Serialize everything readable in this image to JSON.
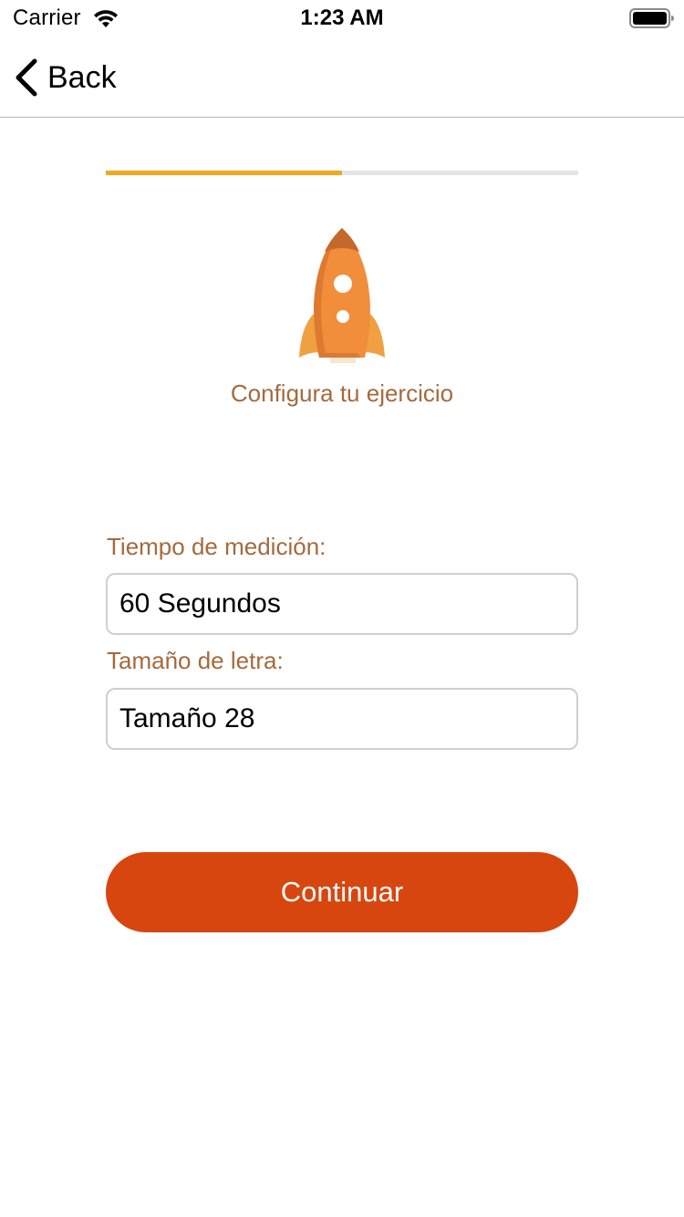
{
  "status_bar": {
    "carrier": "Carrier",
    "time": "1:23 AM",
    "wifi_icon": "wifi-icon",
    "battery_icon": "battery-icon"
  },
  "nav": {
    "back_label": "Back",
    "back_icon": "chevron-left-icon"
  },
  "progress": {
    "fraction": 0.5,
    "fill_color": "#f2a81c",
    "track_color": "#e5e5e5"
  },
  "header": {
    "illustration_icon": "rocket-icon",
    "subtitle": "Configura tu ejercicio"
  },
  "form": {
    "time_label": "Tiempo de medición:",
    "time_value": "60 Segundos",
    "font_label": "Tamaño de letra:",
    "font_value": "Tamaño 28"
  },
  "actions": {
    "continue_label": "Continuar"
  },
  "colors": {
    "accent_label": "#a46a3c",
    "primary_button": "#d8460f",
    "field_border": "#cfcfcf"
  }
}
